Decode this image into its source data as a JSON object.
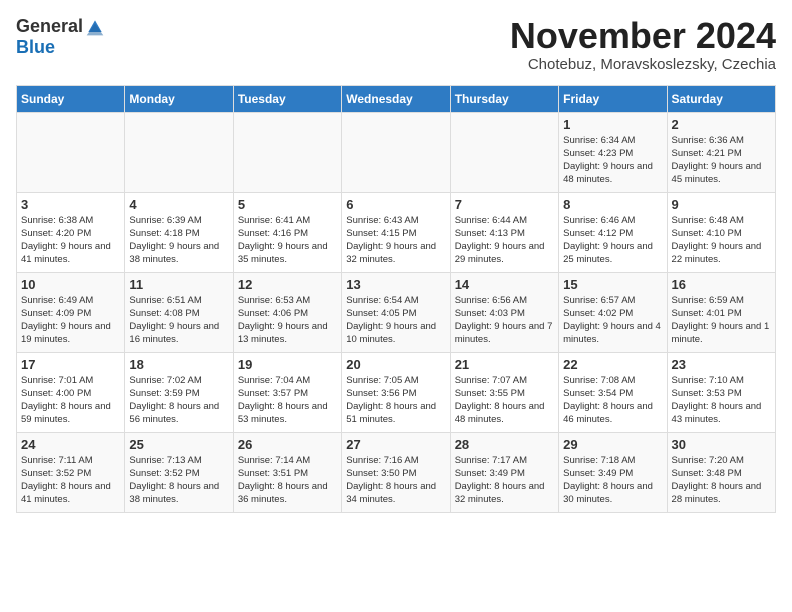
{
  "header": {
    "logo_general": "General",
    "logo_blue": "Blue",
    "month_title": "November 2024",
    "subtitle": "Chotebuz, Moravskoslezsky, Czechia"
  },
  "days_of_week": [
    "Sunday",
    "Monday",
    "Tuesday",
    "Wednesday",
    "Thursday",
    "Friday",
    "Saturday"
  ],
  "weeks": [
    [
      {
        "day": "",
        "info": ""
      },
      {
        "day": "",
        "info": ""
      },
      {
        "day": "",
        "info": ""
      },
      {
        "day": "",
        "info": ""
      },
      {
        "day": "",
        "info": ""
      },
      {
        "day": "1",
        "info": "Sunrise: 6:34 AM\nSunset: 4:23 PM\nDaylight: 9 hours and 48 minutes."
      },
      {
        "day": "2",
        "info": "Sunrise: 6:36 AM\nSunset: 4:21 PM\nDaylight: 9 hours and 45 minutes."
      }
    ],
    [
      {
        "day": "3",
        "info": "Sunrise: 6:38 AM\nSunset: 4:20 PM\nDaylight: 9 hours and 41 minutes."
      },
      {
        "day": "4",
        "info": "Sunrise: 6:39 AM\nSunset: 4:18 PM\nDaylight: 9 hours and 38 minutes."
      },
      {
        "day": "5",
        "info": "Sunrise: 6:41 AM\nSunset: 4:16 PM\nDaylight: 9 hours and 35 minutes."
      },
      {
        "day": "6",
        "info": "Sunrise: 6:43 AM\nSunset: 4:15 PM\nDaylight: 9 hours and 32 minutes."
      },
      {
        "day": "7",
        "info": "Sunrise: 6:44 AM\nSunset: 4:13 PM\nDaylight: 9 hours and 29 minutes."
      },
      {
        "day": "8",
        "info": "Sunrise: 6:46 AM\nSunset: 4:12 PM\nDaylight: 9 hours and 25 minutes."
      },
      {
        "day": "9",
        "info": "Sunrise: 6:48 AM\nSunset: 4:10 PM\nDaylight: 9 hours and 22 minutes."
      }
    ],
    [
      {
        "day": "10",
        "info": "Sunrise: 6:49 AM\nSunset: 4:09 PM\nDaylight: 9 hours and 19 minutes."
      },
      {
        "day": "11",
        "info": "Sunrise: 6:51 AM\nSunset: 4:08 PM\nDaylight: 9 hours and 16 minutes."
      },
      {
        "day": "12",
        "info": "Sunrise: 6:53 AM\nSunset: 4:06 PM\nDaylight: 9 hours and 13 minutes."
      },
      {
        "day": "13",
        "info": "Sunrise: 6:54 AM\nSunset: 4:05 PM\nDaylight: 9 hours and 10 minutes."
      },
      {
        "day": "14",
        "info": "Sunrise: 6:56 AM\nSunset: 4:03 PM\nDaylight: 9 hours and 7 minutes."
      },
      {
        "day": "15",
        "info": "Sunrise: 6:57 AM\nSunset: 4:02 PM\nDaylight: 9 hours and 4 minutes."
      },
      {
        "day": "16",
        "info": "Sunrise: 6:59 AM\nSunset: 4:01 PM\nDaylight: 9 hours and 1 minute."
      }
    ],
    [
      {
        "day": "17",
        "info": "Sunrise: 7:01 AM\nSunset: 4:00 PM\nDaylight: 8 hours and 59 minutes."
      },
      {
        "day": "18",
        "info": "Sunrise: 7:02 AM\nSunset: 3:59 PM\nDaylight: 8 hours and 56 minutes."
      },
      {
        "day": "19",
        "info": "Sunrise: 7:04 AM\nSunset: 3:57 PM\nDaylight: 8 hours and 53 minutes."
      },
      {
        "day": "20",
        "info": "Sunrise: 7:05 AM\nSunset: 3:56 PM\nDaylight: 8 hours and 51 minutes."
      },
      {
        "day": "21",
        "info": "Sunrise: 7:07 AM\nSunset: 3:55 PM\nDaylight: 8 hours and 48 minutes."
      },
      {
        "day": "22",
        "info": "Sunrise: 7:08 AM\nSunset: 3:54 PM\nDaylight: 8 hours and 46 minutes."
      },
      {
        "day": "23",
        "info": "Sunrise: 7:10 AM\nSunset: 3:53 PM\nDaylight: 8 hours and 43 minutes."
      }
    ],
    [
      {
        "day": "24",
        "info": "Sunrise: 7:11 AM\nSunset: 3:52 PM\nDaylight: 8 hours and 41 minutes."
      },
      {
        "day": "25",
        "info": "Sunrise: 7:13 AM\nSunset: 3:52 PM\nDaylight: 8 hours and 38 minutes."
      },
      {
        "day": "26",
        "info": "Sunrise: 7:14 AM\nSunset: 3:51 PM\nDaylight: 8 hours and 36 minutes."
      },
      {
        "day": "27",
        "info": "Sunrise: 7:16 AM\nSunset: 3:50 PM\nDaylight: 8 hours and 34 minutes."
      },
      {
        "day": "28",
        "info": "Sunrise: 7:17 AM\nSunset: 3:49 PM\nDaylight: 8 hours and 32 minutes."
      },
      {
        "day": "29",
        "info": "Sunrise: 7:18 AM\nSunset: 3:49 PM\nDaylight: 8 hours and 30 minutes."
      },
      {
        "day": "30",
        "info": "Sunrise: 7:20 AM\nSunset: 3:48 PM\nDaylight: 8 hours and 28 minutes."
      }
    ]
  ]
}
